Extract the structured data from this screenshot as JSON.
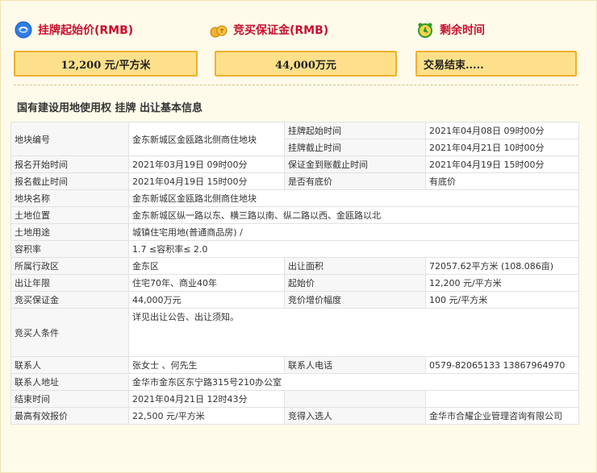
{
  "header": {
    "start_price_title": "挂牌起始价(RMB)",
    "deposit_title": "竞买保证金(RMB)",
    "remaining_title": "剩余时间",
    "start_price_value": "12,200 元/平方米",
    "deposit_value": "44,000万元",
    "remaining_value": "交易结束....."
  },
  "section_title": "国有建设用地使用权 挂牌 出让基本信息",
  "rows": {
    "plot_no_label": "地块编号",
    "plot_no_value": "金东新城区金瓯路北侧商住地块",
    "listing_start_label": "挂牌起始时间",
    "listing_start_value": "2021年04月08日 09时00分",
    "listing_end_label": "挂牌截止时间",
    "listing_end_value": "2021年04月21日 10时00分",
    "reg_start_label": "报名开始时间",
    "reg_start_value": "2021年03月19日 09时00分",
    "deposit_deadline_label": "保证金到账截止时间",
    "deposit_deadline_value": "2021年04月19日 15时00分",
    "reg_end_label": "报名截止时间",
    "reg_end_value": "2021年04月19日 15时00分",
    "reserve_label": "是否有底价",
    "reserve_value": "有底价",
    "name_label": "地块名称",
    "name_value": "金东新城区金瓯路北侧商住地块",
    "location_label": "土地位置",
    "location_value": "金东新城区纵一路以东、横三路以南、纵二路以西、金瓯路以北",
    "use_label": "土地用途",
    "use_value": "城镇住宅用地(普通商品房) /",
    "far_label": "容积率",
    "far_value": "1.7 ≤容积率≤ 2.0",
    "district_label": "所属行政区",
    "district_value": "金东区",
    "area_label": "出让面积",
    "area_value": "72057.62平方米 (108.086亩)",
    "term_label": "出让年限",
    "term_value": "住宅70年、商业40年",
    "start_price_label": "起始价",
    "start_price_value": "12,200 元/平方米",
    "bid_deposit_label": "竞买保证金",
    "bid_deposit_value": "44,000万元",
    "increment_label": "竞价增价幅度",
    "increment_value": "100 元/平方米",
    "conditions_label": "竞买人条件",
    "conditions_value": "详见出让公告、出让须知。",
    "contact_label": "联系人",
    "contact_value": "张女士 、何先生",
    "phone_label": "联系人电话",
    "phone_value": "0579-82065133 13867964970",
    "address_label": "联系人地址",
    "address_value": "金华市金东区东宁路315号210办公室",
    "end_time_label": "结束时间",
    "end_time_value": "2021年04月21日 12时43分",
    "highest_label": "最高有效报价",
    "highest_value": "22,500 元/平方米",
    "winner_label": "竞得入选人",
    "winner_value": "金华市合耀企业管理咨询有限公司"
  },
  "icons": {
    "start_price": "blue-coin-icon",
    "deposit": "coins-icon",
    "remaining": "alarm-clock-icon"
  },
  "colors": {
    "title_red": "#C8102E",
    "box_fill": "#FFE08A",
    "box_border": "#F2AE2E",
    "page_bg": "#FFFBEA"
  }
}
